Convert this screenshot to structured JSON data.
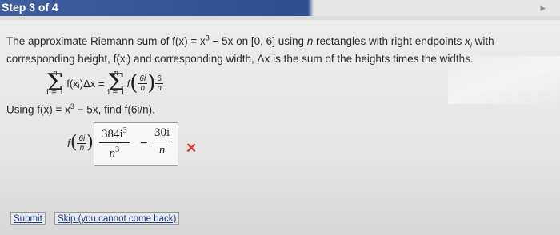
{
  "header": {
    "step_label": "Step 3 of 4",
    "expand_glyph": "▸"
  },
  "question": {
    "line1_a": "The approximate Riemann sum of ",
    "f_of_x": "f(x) = x",
    "exp3": "3",
    "line1_b": " − 5x on [0, 6] using ",
    "n": "n",
    "line1_c": " rectangles with right endpoints ",
    "x_i": "x",
    "i_sub": "i",
    "line1_d": " with",
    "line2": "corresponding height, f(xᵢ) and corresponding width, Δx is the sum of the heights times the widths."
  },
  "sum_formula": {
    "upper": "n",
    "lower": "i = 1",
    "lhs_term": "f(xᵢ)Δx =",
    "rhs_f": "f",
    "frac_num": "6i",
    "frac_den": "n",
    "w_num": "6",
    "w_den": "n"
  },
  "using_line": {
    "text_a": "Using ",
    "fx": "f(x) = x",
    "exp3": "3",
    "text_b": " − 5x, find f(6i/n)."
  },
  "answer": {
    "lhs_f": "f",
    "lhs_num": "6i",
    "lhs_den": "n",
    "equals": "=",
    "term1_num": "384i",
    "term1_num_exp": "3",
    "term1_den": "n",
    "term1_den_exp": "3",
    "minus": "−",
    "term2_num": "30i",
    "term2_den": "n",
    "status_icon": "incorrect-x-icon",
    "status_glyph": "✕"
  },
  "buttons": {
    "submit": "Submit",
    "skip": "Skip (you cannot come back)"
  },
  "colors": {
    "header_blue": "#2f4f8f",
    "error_red": "#d23a3a",
    "link_blue": "#1b3c8a"
  }
}
